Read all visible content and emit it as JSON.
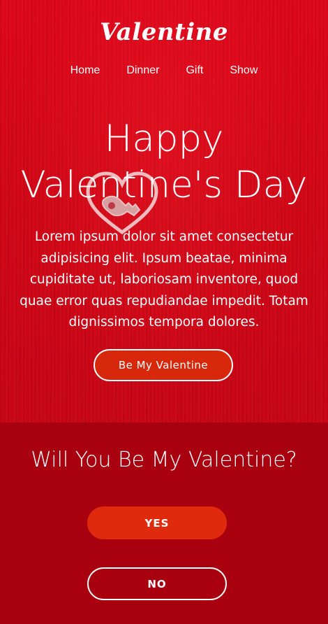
{
  "header": {
    "brand": "Valentine",
    "nav": [
      {
        "label": "Home"
      },
      {
        "label": "Dinner"
      },
      {
        "label": "Gift"
      },
      {
        "label": "Show"
      }
    ]
  },
  "hero": {
    "headline_line1": "Happy",
    "headline_line2": "Valentine's Day",
    "lead": "Lorem ipsum dolor sit amet consectetur adipisicing elit. Ipsum beatae, minima cupiditate ut, laboriosam inventore, quod quae error quas repudiandae impedit. Totam dignissimos tempora dolores.",
    "cta_label": "Be My Valentine",
    "graphic_icon": "heart-key-icon"
  },
  "question": {
    "title": "Will You Be My Valentine?",
    "yes_label": "YES",
    "no_label": "NO"
  },
  "colors": {
    "hero_red": "#d40616",
    "section_red": "#a8000f",
    "button_orange": "#df2a0e",
    "text": "#ffffff"
  }
}
